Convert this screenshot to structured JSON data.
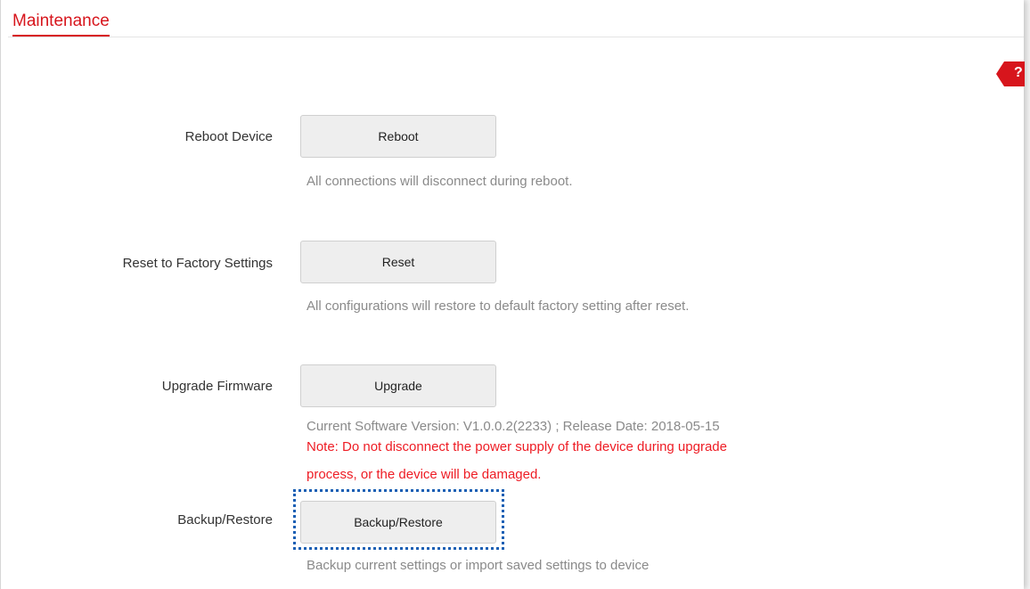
{
  "page": {
    "title": "Maintenance",
    "help_icon": "question-mark-icon",
    "help_label": "?"
  },
  "colors": {
    "accent": "#d7151c",
    "note": "#ee1c24",
    "hint": "#8a8a8a",
    "focus": "#1a5fb4"
  },
  "reboot": {
    "label": "Reboot Device",
    "button": "Reboot",
    "hint": "All connections will disconnect during reboot."
  },
  "reset": {
    "label": "Reset to Factory Settings",
    "button": "Reset",
    "hint": "All configurations will restore to default factory setting after reset."
  },
  "upgrade": {
    "label": "Upgrade Firmware",
    "button": "Upgrade",
    "version": "Current Software Version: V1.0.0.2(2233) ; Release Date: 2018-05-15",
    "note_line1": "Note: Do not disconnect the power supply of the device during upgrade",
    "note_line2": "process, or the device will be damaged."
  },
  "backup": {
    "label": "Backup/Restore",
    "button": "Backup/Restore",
    "hint": "Backup current settings or import saved settings to device"
  }
}
